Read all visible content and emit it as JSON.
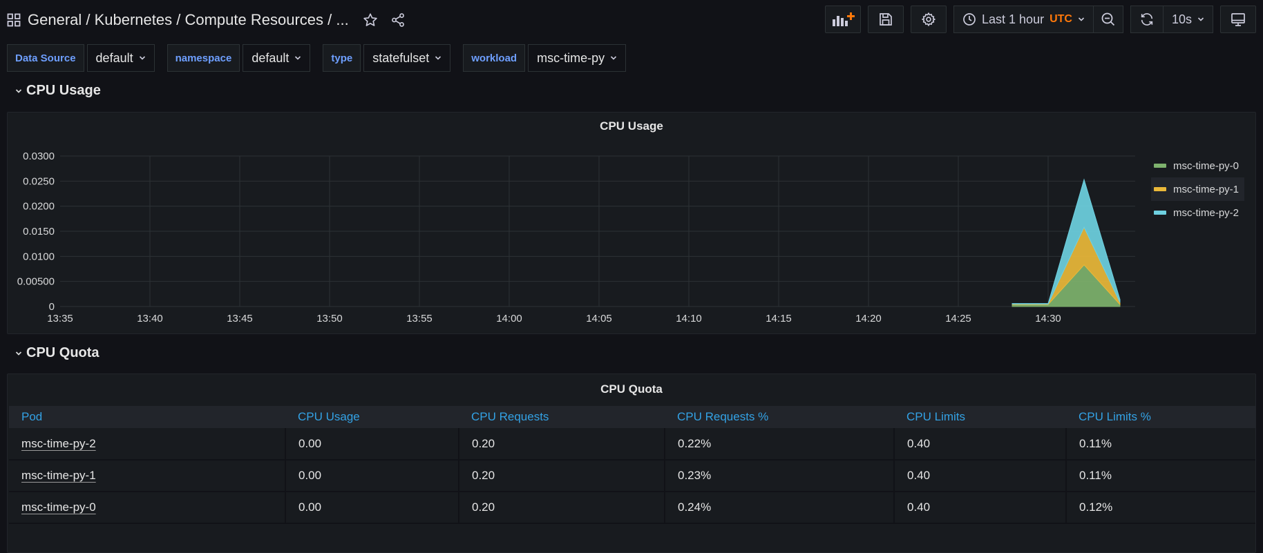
{
  "header": {
    "breadcrumb": "General  / Kubernetes / Compute Resources / ...",
    "time_range": "Last 1 hour",
    "timezone": "UTC",
    "refresh_interval": "10s",
    "icons": [
      "grid-icon",
      "star-icon",
      "share-icon",
      "add-panel-icon",
      "save-icon",
      "gear-icon",
      "clock-icon",
      "zoom-out-icon",
      "refresh-icon",
      "tv-icon"
    ]
  },
  "variables": [
    {
      "label": "Data Source",
      "value": "default"
    },
    {
      "label": "namespace",
      "value": "default"
    },
    {
      "label": "type",
      "value": "statefulset"
    },
    {
      "label": "workload",
      "value": "msc-time-py"
    }
  ],
  "rows": {
    "cpu_usage": "CPU Usage",
    "cpu_quota": "CPU Quota"
  },
  "cpu_usage_panel": {
    "title": "CPU Usage",
    "chart_data": {
      "type": "area",
      "stacked": true,
      "x_ticks": [
        "13:35",
        "13:40",
        "13:45",
        "13:50",
        "13:55",
        "14:00",
        "14:05",
        "14:10",
        "14:15",
        "14:20",
        "14:25",
        "14:30"
      ],
      "y_ticks": [
        "0",
        "0.00500",
        "0.0100",
        "0.0150",
        "0.0200",
        "0.0250",
        "0.0300"
      ],
      "ylim": [
        0,
        0.03
      ],
      "x": [
        "14:28",
        "14:30",
        "14:32",
        "14:34"
      ],
      "series": [
        {
          "name": "msc-time-py-0",
          "color": "#7eb26d",
          "values": [
            0.0004,
            0.0004,
            0.0083,
            0.0004
          ]
        },
        {
          "name": "msc-time-py-1",
          "color": "#eab839",
          "values": [
            0.0001,
            0.0001,
            0.0075,
            0.0004
          ]
        },
        {
          "name": "msc-time-py-2",
          "color": "#6ed0e0",
          "values": [
            0.0001,
            0.0001,
            0.0095,
            0.0006
          ]
        }
      ],
      "grid": true,
      "legend": "right"
    }
  },
  "cpu_quota_panel": {
    "title": "CPU Quota",
    "columns": [
      "Pod",
      "CPU Usage",
      "CPU Requests",
      "CPU Requests %",
      "CPU Limits",
      "CPU Limits %"
    ],
    "rows": [
      [
        "msc-time-py-2",
        "0.00",
        "0.20",
        "0.22%",
        "0.40",
        "0.11%"
      ],
      [
        "msc-time-py-1",
        "0.00",
        "0.20",
        "0.23%",
        "0.40",
        "0.11%"
      ],
      [
        "msc-time-py-0",
        "0.00",
        "0.20",
        "0.24%",
        "0.40",
        "0.12%"
      ]
    ]
  }
}
